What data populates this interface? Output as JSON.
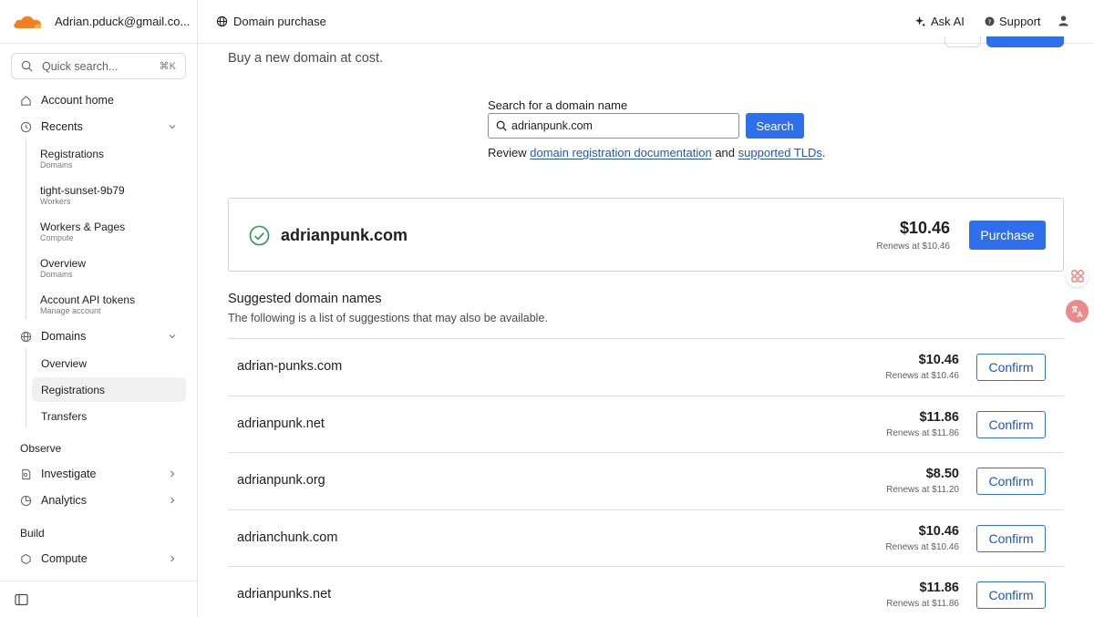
{
  "account": {
    "email": "Adrian.pduck@gmail.co..."
  },
  "sidebar": {
    "search": {
      "placeholder": "Quick search...",
      "shortcut": "⌘K"
    },
    "account_home": "Account home",
    "recents_label": "Recents",
    "recents": [
      {
        "title": "Registrations",
        "sub": "Domains"
      },
      {
        "title": "tight-sunset-9b79",
        "sub": "Workers"
      },
      {
        "title": "Workers & Pages",
        "sub": "Compute"
      },
      {
        "title": "Overview",
        "sub": "Domains"
      },
      {
        "title": "Account API tokens",
        "sub": "Manage account"
      }
    ],
    "domains_label": "Domains",
    "domains_items": [
      "Overview",
      "Registrations",
      "Transfers"
    ],
    "observe_label": "Observe",
    "investigate_label": "Investigate",
    "analytics_label": "Analytics",
    "build_label": "Build",
    "compute_label": "Compute"
  },
  "topbar": {
    "breadcrumb": "Domain purchase",
    "ask_ai": "Ask AI",
    "support": "Support"
  },
  "main": {
    "subtitle": "Buy a new domain at cost.",
    "search_label": "Search for a domain name",
    "search_value": "adrianpunk.com",
    "search_button": "Search",
    "review_prefix": "Review",
    "review_link1": "domain registration documentation",
    "review_and": "and",
    "review_link2": "supported TLDs",
    "review_suffix": ".",
    "result": {
      "domain": "adrianpunk.com",
      "price": "$10.46",
      "renews": "Renews at $10.46",
      "button": "Purchase"
    },
    "suggestions_title": "Suggested domain names",
    "suggestions_desc": "The following is a list of suggestions that may also be available.",
    "suggestions": [
      {
        "domain": "adrian-punks.com",
        "price": "$10.46",
        "renews": "Renews at $10.46",
        "button": "Confirm"
      },
      {
        "domain": "adrianpunk.net",
        "price": "$11.86",
        "renews": "Renews at $11.86",
        "button": "Confirm"
      },
      {
        "domain": "adrianpunk.org",
        "price": "$8.50",
        "renews": "Renews at $11.20",
        "button": "Confirm"
      },
      {
        "domain": "adrianchunk.com",
        "price": "$10.46",
        "renews": "Renews at $10.46",
        "button": "Confirm"
      },
      {
        "domain": "adrianpunks.net",
        "price": "$11.86",
        "renews": "Renews at $11.86",
        "button": "Confirm"
      }
    ]
  },
  "colors": {
    "accent": "#2f6feb",
    "link": "#1a55c9",
    "success": "#3a9a5b",
    "logo": "#f38020"
  }
}
